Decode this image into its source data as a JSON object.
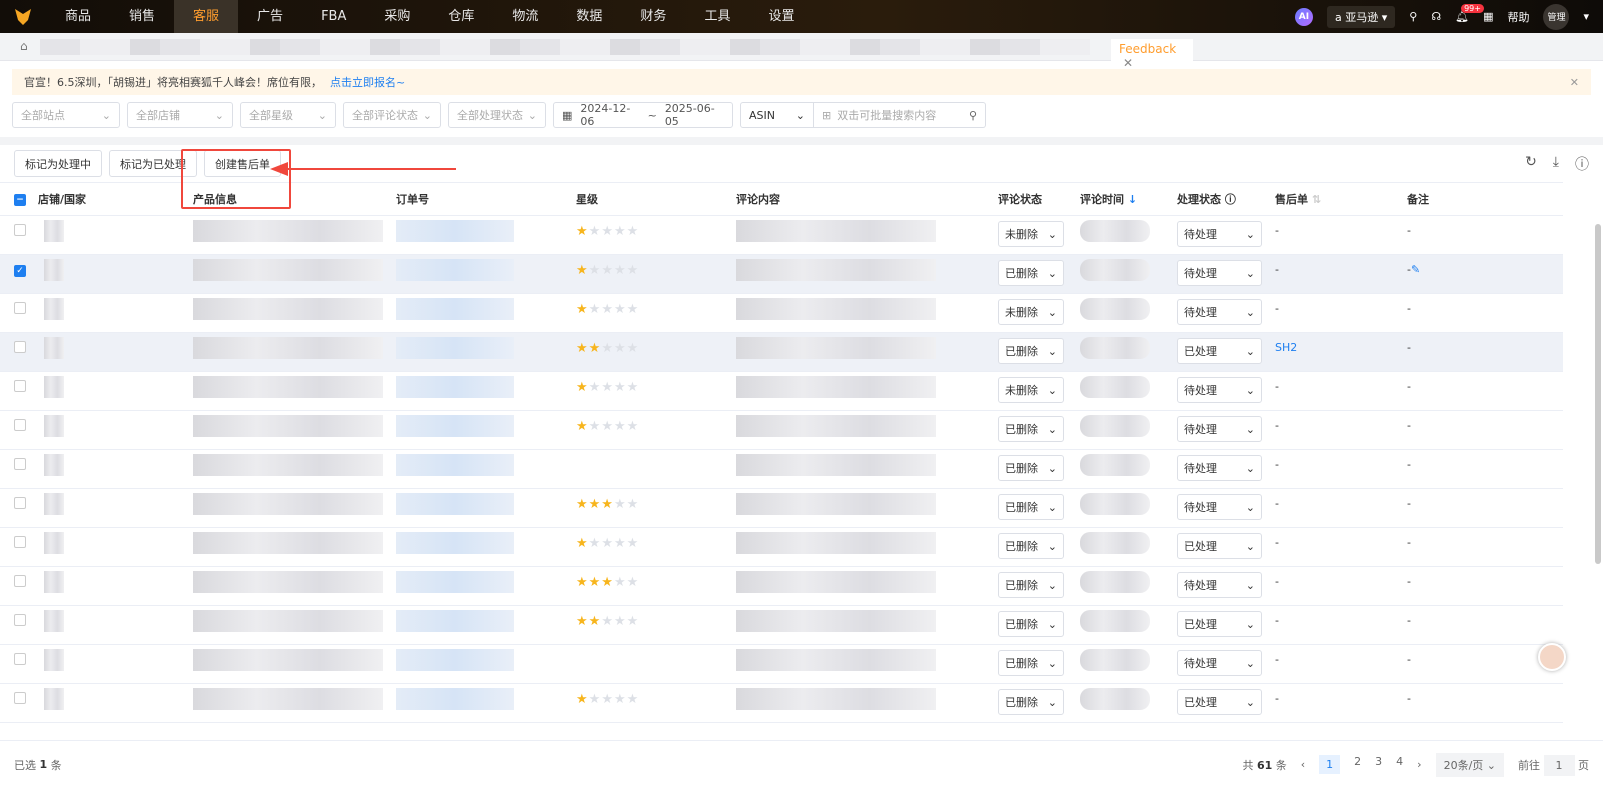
{
  "nav": {
    "items": [
      "商品",
      "销售",
      "客服",
      "广告",
      "FBA",
      "采购",
      "仓库",
      "物流",
      "数据",
      "财务",
      "工具",
      "设置"
    ],
    "active": 2,
    "ai": "AI",
    "marketplace": "亚马逊",
    "notif_badge": "99+",
    "help": "帮助",
    "user": "管理"
  },
  "tabs": {
    "active": "Feedback"
  },
  "notice": {
    "text": "官宣！6.5深圳，「胡锡进」将亮相赛狐千人峰会！席位有限，",
    "link": "点击立即报名~"
  },
  "filters": {
    "site": "全部站点",
    "shop": "全部店铺",
    "star": "全部星级",
    "review_status": "全部评论状态",
    "process_status": "全部处理状态",
    "date_start": "2024-12-06",
    "date_sep": "~",
    "date_end": "2025-06-05",
    "search_type": "ASIN",
    "search_placeholder": "双击可批量搜索内容"
  },
  "toolbar": {
    "mark_processing": "标记为处理中",
    "mark_processed": "标记为已处理",
    "create_aftersale": "创建售后单"
  },
  "columns": [
    "店铺/国家",
    "产品信息",
    "订单号",
    "星级",
    "评论内容",
    "评论状态",
    "评论时间",
    "处理状态",
    "售后单",
    "备注"
  ],
  "rows": [
    {
      "checked": false,
      "stars": 1,
      "review": "未删除",
      "process": "待处理",
      "aftersale": "-",
      "note": "-"
    },
    {
      "checked": true,
      "stars": 1,
      "review": "已删除",
      "process": "待处理",
      "aftersale": "-",
      "note": "-"
    },
    {
      "checked": false,
      "stars": 1,
      "review": "未删除",
      "process": "待处理",
      "aftersale": "-",
      "note": "-"
    },
    {
      "checked": false,
      "stars": 2,
      "review": "已删除",
      "process": "已处理",
      "aftersale": "SH2",
      "note": "-"
    },
    {
      "checked": false,
      "stars": 1,
      "review": "未删除",
      "process": "待处理",
      "aftersale": "-",
      "note": "-"
    },
    {
      "checked": false,
      "stars": 1,
      "review": "已删除",
      "process": "待处理",
      "aftersale": "-",
      "note": "-"
    },
    {
      "checked": false,
      "stars": 0,
      "review": "已删除",
      "process": "待处理",
      "aftersale": "-",
      "note": "-"
    },
    {
      "checked": false,
      "stars": 3,
      "review": "已删除",
      "process": "待处理",
      "aftersale": "-",
      "note": "-"
    },
    {
      "checked": false,
      "stars": 1,
      "review": "已删除",
      "process": "已处理",
      "aftersale": "-",
      "note": "-"
    },
    {
      "checked": false,
      "stars": 3,
      "review": "已删除",
      "process": "待处理",
      "aftersale": "-",
      "note": "-"
    },
    {
      "checked": false,
      "stars": 2,
      "review": "已删除",
      "process": "已处理",
      "aftersale": "-",
      "note": "-"
    },
    {
      "checked": false,
      "stars": 0,
      "review": "已删除",
      "process": "待处理",
      "aftersale": "-",
      "note": "-"
    },
    {
      "checked": false,
      "stars": 1,
      "review": "已删除",
      "process": "已处理",
      "aftersale": "-",
      "note": "-"
    }
  ],
  "footer": {
    "selected_prefix": "已选",
    "selected_count": "1",
    "selected_suffix": "条",
    "total_prefix": "共",
    "total": "61",
    "total_suffix": "条",
    "pages": [
      "1",
      "2",
      "3",
      "4"
    ],
    "current_page": "1",
    "page_size": "20条/页",
    "goto_prefix": "前往",
    "goto_value": "1",
    "goto_suffix": "页"
  },
  "colors": {
    "accent": "#ff9d2e",
    "link": "#1e7ff0",
    "star": "#f7b51d",
    "annotation": "#f0473c"
  }
}
